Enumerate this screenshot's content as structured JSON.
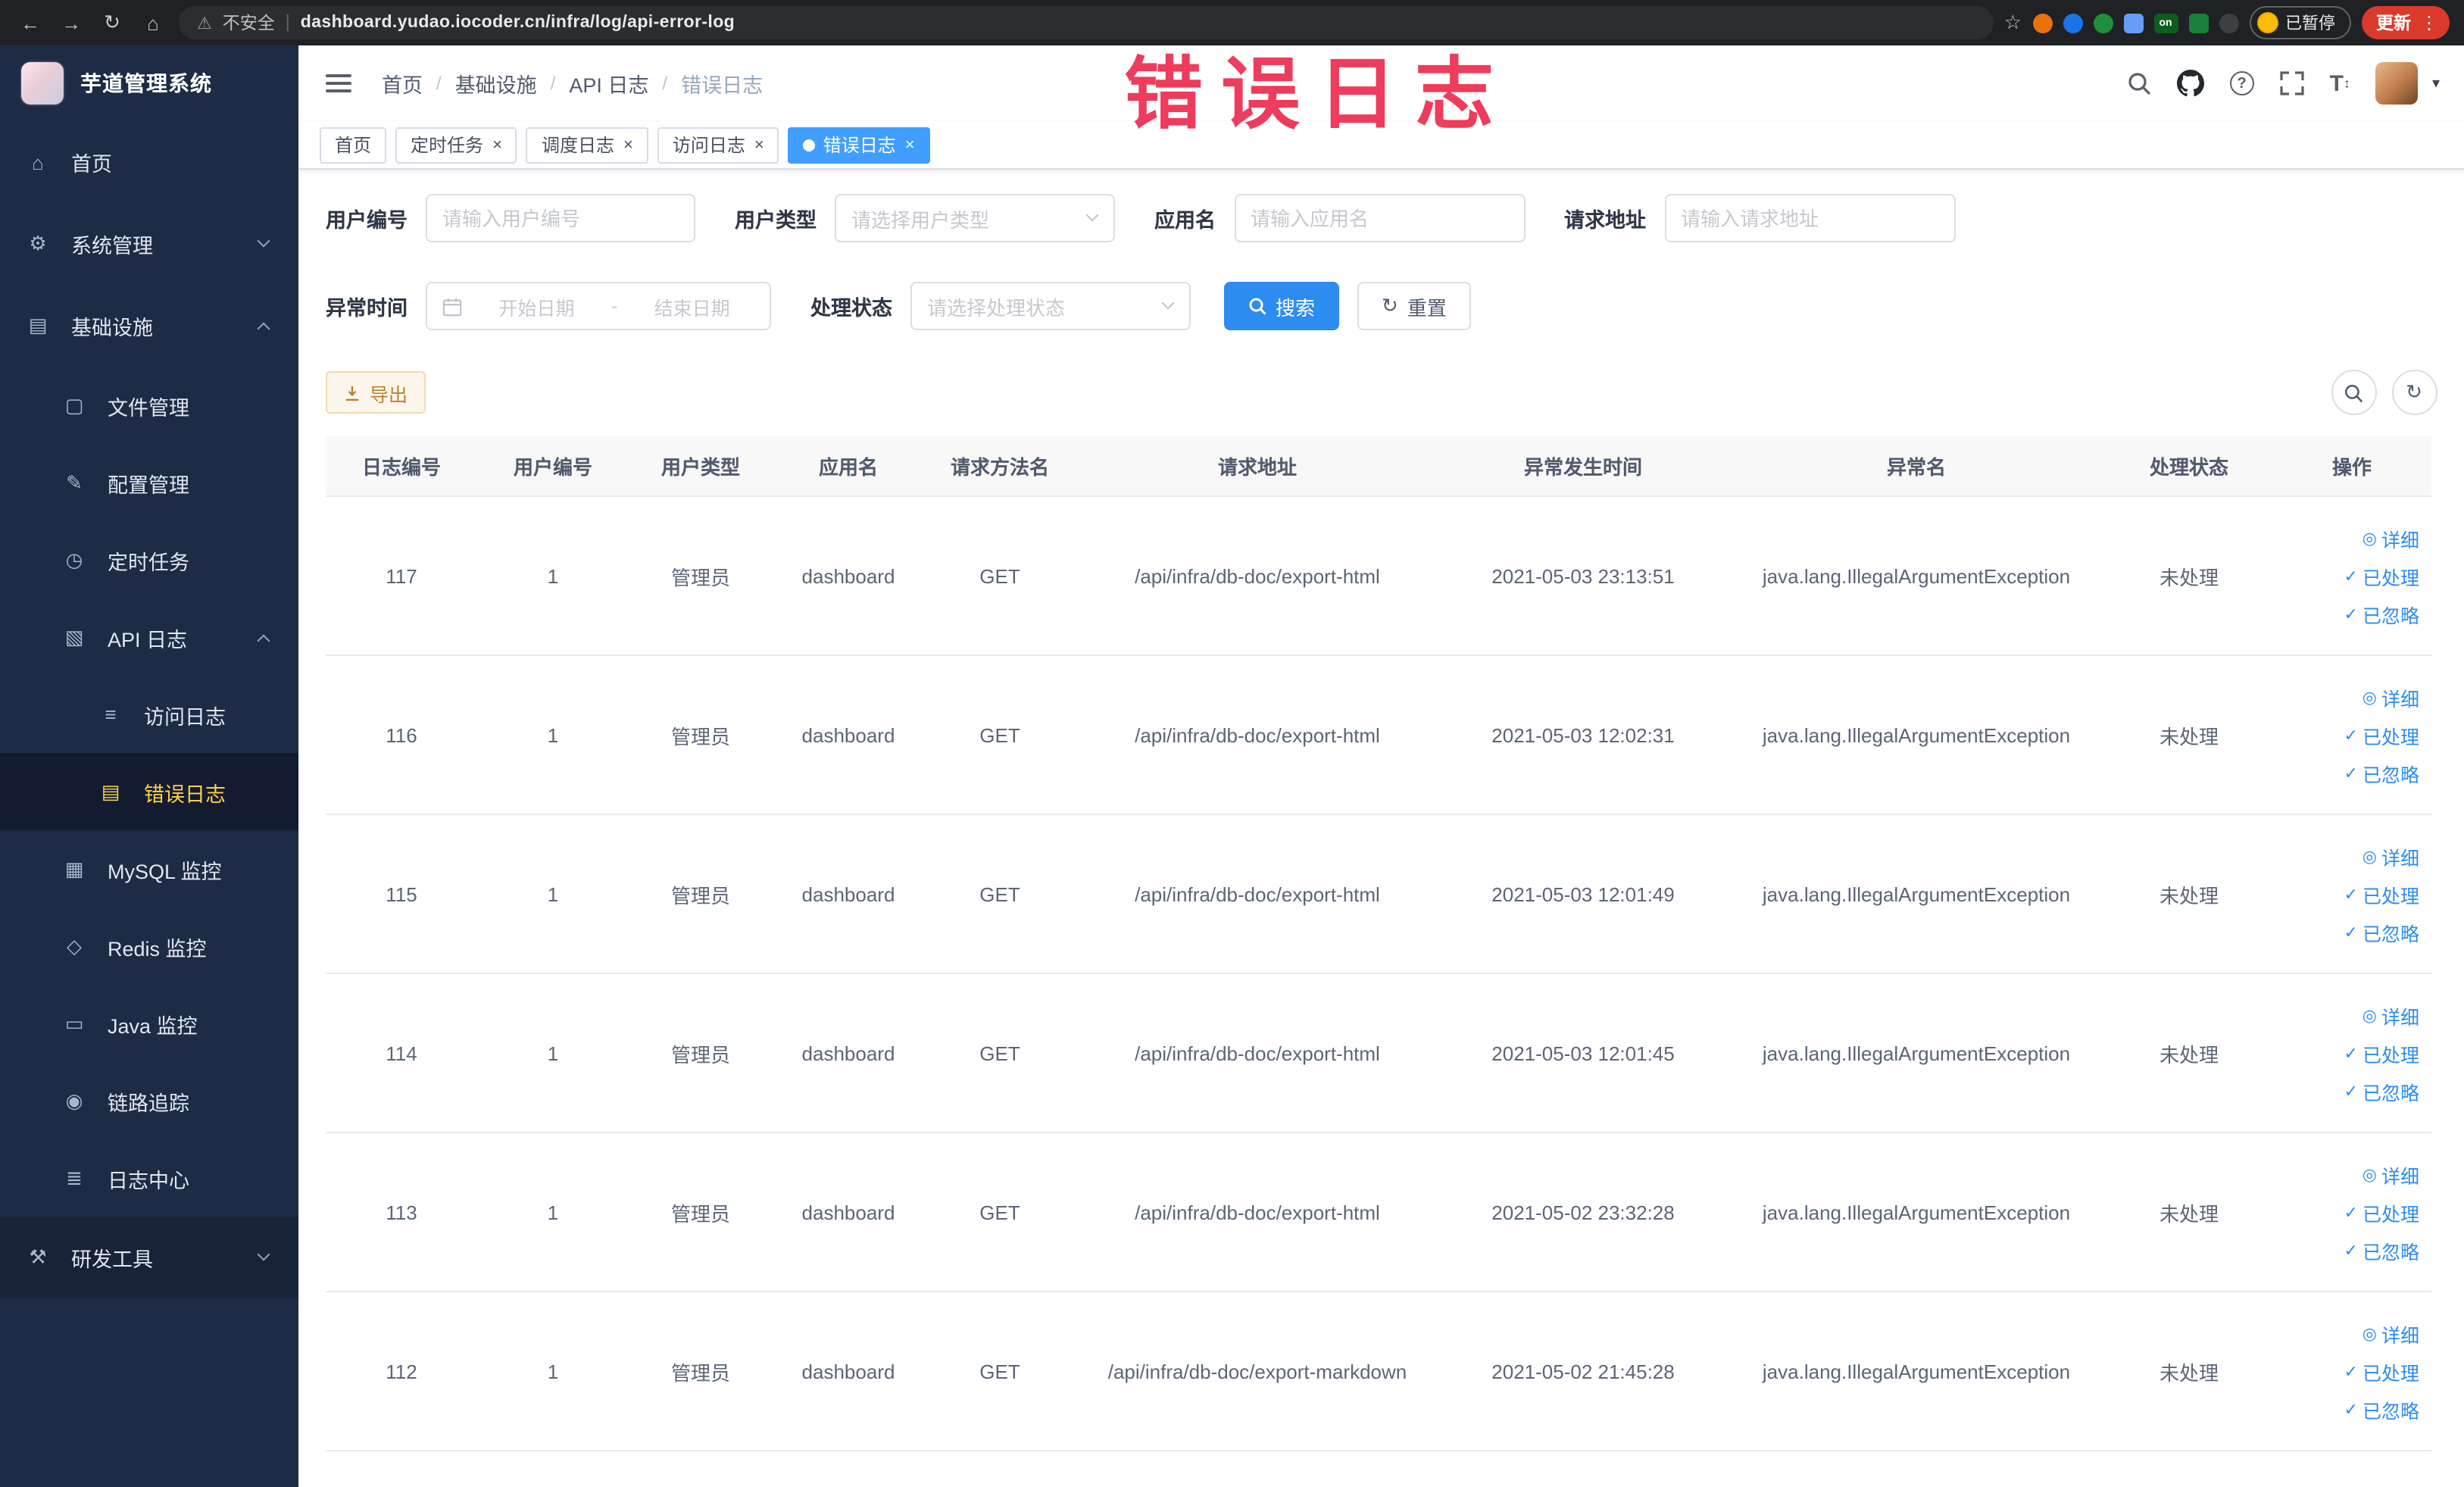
{
  "browser": {
    "security": "不安全",
    "url": "dashboard.yudao.iocoder.cn/infra/log/api-error-log",
    "paused": "已暂停",
    "update": "更新",
    "ext_on": "on"
  },
  "icons": {
    "back": "←",
    "forward": "→",
    "reload": "↻",
    "home": "⌂",
    "warning": "⚠",
    "separator": "|",
    "star": "☆",
    "kebab": "⋮",
    "close": "×",
    "slash": "/",
    "caret": "▾",
    "question": "?",
    "fontsize_t": "T",
    "fontsize_arrows": "↕",
    "refresh": "↻",
    "eye": "◎",
    "check": "✓"
  },
  "sidebar": {
    "app_title": "芋道管理系统",
    "items": [
      {
        "label": "首页",
        "icon": "⌂"
      },
      {
        "label": "系统管理",
        "icon": "⚙"
      },
      {
        "label": "基础设施",
        "icon": "▤"
      },
      {
        "label": "文件管理",
        "icon": "▢"
      },
      {
        "label": "配置管理",
        "icon": "✎"
      },
      {
        "label": "定时任务",
        "icon": "◷"
      },
      {
        "label": "API 日志",
        "icon": "▧"
      },
      {
        "label": "访问日志",
        "icon": "≡"
      },
      {
        "label": "错误日志",
        "icon": "▤"
      },
      {
        "label": "MySQL 监控",
        "icon": "▦"
      },
      {
        "label": "Redis 监控",
        "icon": "◇"
      },
      {
        "label": "Java 监控",
        "icon": "▭"
      },
      {
        "label": "链路追踪",
        "icon": "◉"
      },
      {
        "label": "日志中心",
        "icon": "≣"
      },
      {
        "label": "研发工具",
        "icon": "⚒"
      }
    ]
  },
  "header": {
    "breadcrumb": [
      "首页",
      "基础设施",
      "API 日志",
      "错误日志"
    ]
  },
  "tabs": [
    {
      "label": "首页"
    },
    {
      "label": "定时任务"
    },
    {
      "label": "调度日志"
    },
    {
      "label": "访问日志"
    },
    {
      "label": "错误日志"
    }
  ],
  "annotation": {
    "text": "错误日志"
  },
  "filters": {
    "user_id": {
      "label": "用户编号",
      "placeholder": "请输入用户编号"
    },
    "user_type": {
      "label": "用户类型",
      "placeholder": "请选择用户类型"
    },
    "app_name": {
      "label": "应用名",
      "placeholder": "请输入应用名"
    },
    "request_url": {
      "label": "请求地址",
      "placeholder": "请输入请求地址"
    },
    "exception_time": {
      "label": "异常时间",
      "start_placeholder": "开始日期",
      "separator": "-",
      "end_placeholder": "结束日期"
    },
    "process_status": {
      "label": "处理状态",
      "placeholder": "请选择处理状态"
    },
    "search_label": "搜索",
    "reset_label": "重置"
  },
  "toolbar": {
    "export_label": "导出"
  },
  "table": {
    "columns": [
      "日志编号",
      "用户编号",
      "用户类型",
      "应用名",
      "请求方法名",
      "请求地址",
      "异常发生时间",
      "异常名",
      "处理状态",
      "操作"
    ],
    "actions": {
      "detail": "详细",
      "processed": "已处理",
      "ignored": "已忽略"
    },
    "rows": [
      {
        "id": "117",
        "user_id": "1",
        "user_type": "管理员",
        "app": "dashboard",
        "method": "GET",
        "url": "/api/infra/db-doc/export-html",
        "time": "2021-05-03 23:13:51",
        "exception": "java.lang.IllegalArgumentException",
        "status": "未处理"
      },
      {
        "id": "116",
        "user_id": "1",
        "user_type": "管理员",
        "app": "dashboard",
        "method": "GET",
        "url": "/api/infra/db-doc/export-html",
        "time": "2021-05-03 12:02:31",
        "exception": "java.lang.IllegalArgumentException",
        "status": "未处理"
      },
      {
        "id": "115",
        "user_id": "1",
        "user_type": "管理员",
        "app": "dashboard",
        "method": "GET",
        "url": "/api/infra/db-doc/export-html",
        "time": "2021-05-03 12:01:49",
        "exception": "java.lang.IllegalArgumentException",
        "status": "未处理"
      },
      {
        "id": "114",
        "user_id": "1",
        "user_type": "管理员",
        "app": "dashboard",
        "method": "GET",
        "url": "/api/infra/db-doc/export-html",
        "time": "2021-05-03 12:01:45",
        "exception": "java.lang.IllegalArgumentException",
        "status": "未处理"
      },
      {
        "id": "113",
        "user_id": "1",
        "user_type": "管理员",
        "app": "dashboard",
        "method": "GET",
        "url": "/api/infra/db-doc/export-html",
        "time": "2021-05-02 23:32:28",
        "exception": "java.lang.IllegalArgumentException",
        "status": "未处理"
      },
      {
        "id": "112",
        "user_id": "1",
        "user_type": "管理员",
        "app": "dashboard",
        "method": "GET",
        "url": "/api/infra/db-doc/export-markdown",
        "time": "2021-05-02 21:45:28",
        "exception": "java.lang.IllegalArgumentException",
        "status": "未处理"
      }
    ]
  }
}
